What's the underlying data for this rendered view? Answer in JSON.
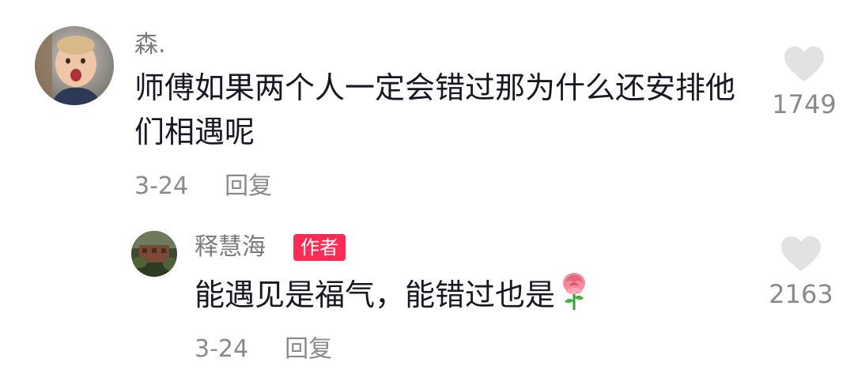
{
  "comments": [
    {
      "username": "森.",
      "text": "师傅如果两个人一定会错过那为什么还安排他们相遇呢",
      "date": "3-24",
      "reply_label": "回复",
      "like_count": "1749",
      "avatar_icon": "toddler-avatar"
    }
  ],
  "reply": {
    "username": "释慧海",
    "badge": "作者",
    "text": "能遇见是福气，能错过也是",
    "emoji_icon": "rose-icon",
    "date": "3-24",
    "reply_label": "回复",
    "like_count": "2163",
    "avatar_icon": "garden-avatar"
  },
  "colors": {
    "badge": "#fe2c55",
    "username": "#7a7a7a",
    "content": "#161823",
    "meta": "#8a8a8a",
    "heart": "#e2e2e4"
  }
}
